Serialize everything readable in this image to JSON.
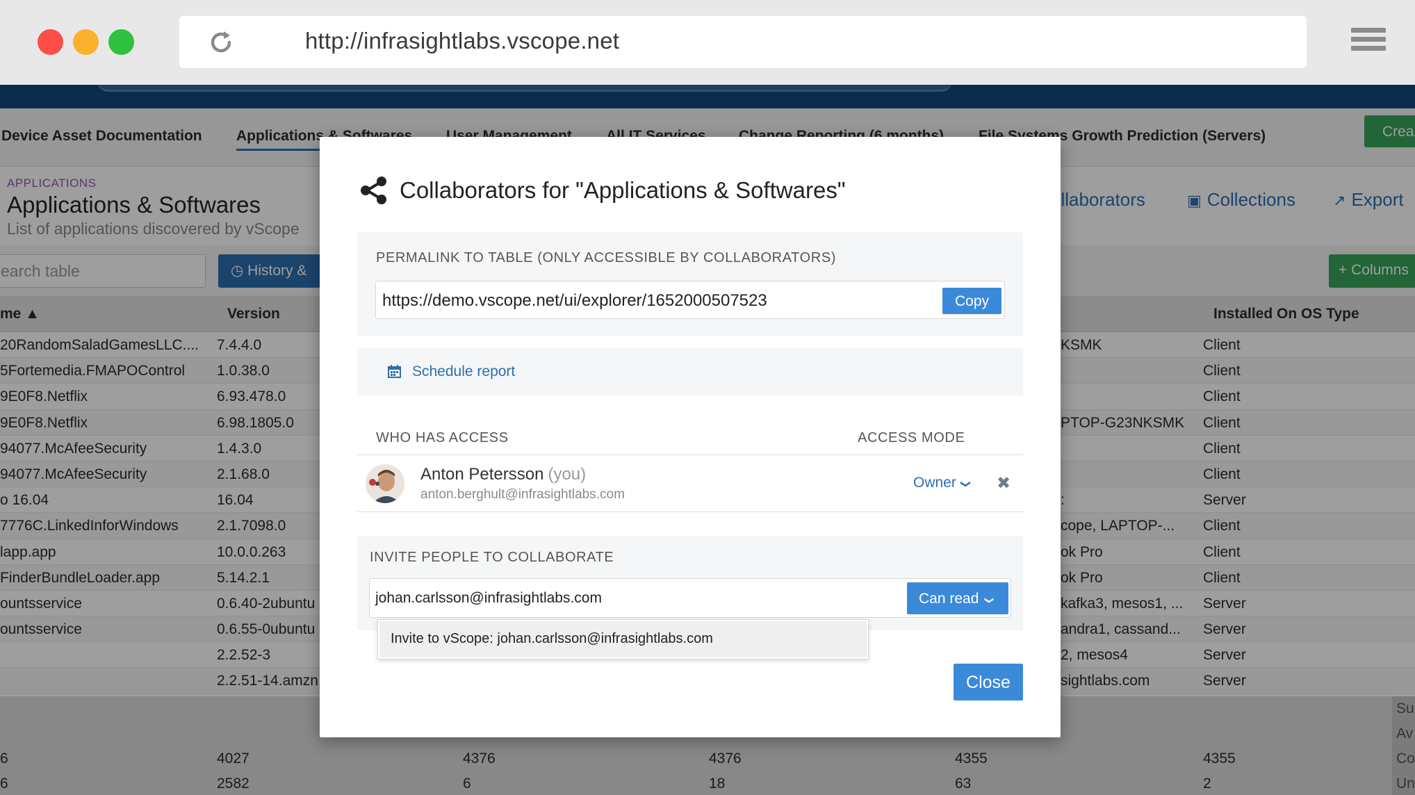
{
  "browser": {
    "url": "http://infrasightlabs.vscope.net"
  },
  "nav": {
    "tabs": [
      {
        "label": "Device Asset Documentation"
      },
      {
        "label": "Applications & Softwares"
      },
      {
        "label": "User Management"
      },
      {
        "label": "All IT Services"
      },
      {
        "label": "Change Reporting (6 months)"
      },
      {
        "label": "File Systems Growth Prediction (Servers)"
      }
    ],
    "create_label": "Crea"
  },
  "page": {
    "breadcrumb": "APPLICATIONS",
    "title": "Applications & Softwares",
    "subtitle": "List of applications discovered by vScope",
    "collaborators_label": "ollaborators",
    "collections_label": "Collections",
    "export_label": "Export"
  },
  "toolbar": {
    "search_placeholder": "earch table",
    "history_label": "History &",
    "columns_label": "Columns"
  },
  "table": {
    "headers": {
      "name": "me ▲",
      "version": "Version",
      "os_type": "Installed On OS Type"
    },
    "rows": [
      {
        "name": "20RandomSaladGamesLLC....",
        "version": "7.4.4.0",
        "host": "KSMK",
        "os": "Client"
      },
      {
        "name": "5Fortemedia.FMAPOControl",
        "version": "1.0.38.0",
        "host": "",
        "os": "Client"
      },
      {
        "name": "9E0F8.Netflix",
        "version": "6.93.478.0",
        "host": "",
        "os": "Client"
      },
      {
        "name": "9E0F8.Netflix",
        "version": "6.98.1805.0",
        "host": "PTOP-G23NKSMK",
        "os": "Client"
      },
      {
        "name": "94077.McAfeeSecurity",
        "version": "1.4.3.0",
        "host": "",
        "os": "Client"
      },
      {
        "name": "94077.McAfeeSecurity",
        "version": "2.1.68.0",
        "host": "",
        "os": "Client"
      },
      {
        "name": "o 16.04",
        "version": "16.04",
        "host": ":",
        "os": "Server"
      },
      {
        "name": "7776C.LinkedInforWindows",
        "version": "2.1.7098.0",
        "host": "cope, LAPTOP-...",
        "os": "Client"
      },
      {
        "name": "lapp.app",
        "version": "10.0.0.263",
        "host": "ok Pro",
        "os": "Client"
      },
      {
        "name": "FinderBundleLoader.app",
        "version": "5.14.2.1",
        "host": "ok Pro",
        "os": "Client"
      },
      {
        "name": "ountsservice",
        "version": "0.6.40-2ubuntu",
        "host": "kafka3, mesos1, ...",
        "os": "Server"
      },
      {
        "name": "ountsservice",
        "version": "0.6.55-0ubuntu",
        "host": "andra1, cassand...",
        "os": "Server"
      },
      {
        "name": "",
        "version": "2.2.52-3",
        "host": "2, mesos4",
        "os": "Server"
      },
      {
        "name": "",
        "version": "2.2.51-14.amzn",
        "host": "sightlabs.com",
        "os": "Server"
      }
    ],
    "summary": {
      "side_labels": [
        "Su",
        "Av",
        "Co",
        "Un"
      ],
      "row3": [
        "6",
        "4027",
        "4376",
        "4376",
        "4355",
        "4355"
      ],
      "row4": [
        "6",
        "2582",
        "6",
        "18",
        "63",
        "2"
      ]
    }
  },
  "modal": {
    "title": "Collaborators for \"Applications & Softwares\"",
    "permalink_label": "PERMALINK TO TABLE (ONLY ACCESSIBLE BY COLLABORATORS)",
    "permalink_url": "https://demo.vscope.net/ui/explorer/1652000507523",
    "copy_label": "Copy",
    "schedule_label": "Schedule report",
    "who_has_access": "WHO HAS ACCESS",
    "access_mode": "ACCESS MODE",
    "user": {
      "name": "Anton Petersson",
      "you": "(you)",
      "email": "anton.berghult@infrasightlabs.com",
      "mode": "Owner"
    },
    "invite_label": "INVITE PEOPLE TO COLLABORATE",
    "invite_value": "johan.carlsson@infrasightlabs.com",
    "invite_mode": "Can read",
    "suggestion": "Invite to vScope: johan.carlsson@infrasightlabs.com",
    "close_label": "Close"
  },
  "colors": {
    "primary": "#3b8ad9",
    "link": "#2d6fb0",
    "success": "#38a35a",
    "header_band": "#134a7c"
  }
}
